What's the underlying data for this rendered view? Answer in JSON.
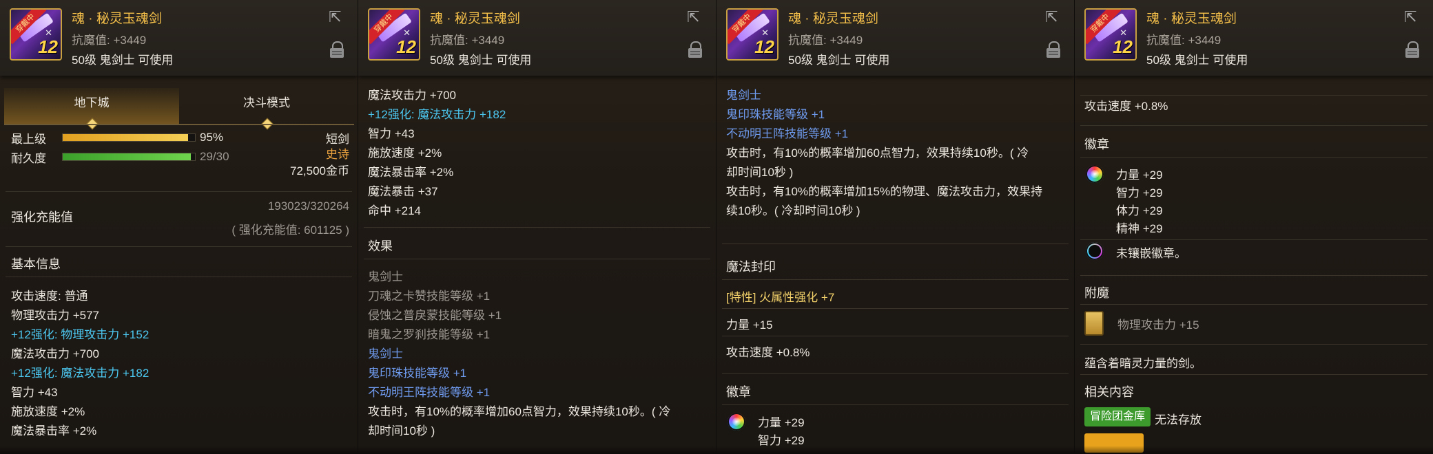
{
  "header": {
    "item_name": "魂 · 秘灵玉魂剑",
    "resistance": "抗魔值: +3449",
    "usage": "50级 鬼剑士 可使用",
    "icon_level": "12",
    "icon_ribbon": "穿戴中"
  },
  "panel1": {
    "tabs": [
      "地下城",
      "决斗模式"
    ],
    "grade_label": "最上级",
    "grade_value": "95%",
    "grade_fraction": 0.95,
    "durability_label": "耐久度",
    "durability_value": "29/30",
    "durability_fraction": 0.967,
    "weapon_type": "短剑",
    "rarity": "史诗",
    "price": "72,500金币",
    "charge_label": "强化充能值",
    "charge_value": "193023/320264",
    "charge_sub": "( 强化充能值: 601125 )",
    "basic_title": "基本信息",
    "lines": [
      "攻击速度: 普通",
      "物理攻击力 +577",
      "+12强化: 物理攻击力 +152",
      "魔法攻击力 +700",
      "+12强化: 魔法攻击力 +182",
      "智力 +43",
      "施放速度 +2%",
      "魔法暴击率 +2%"
    ]
  },
  "panel2": {
    "lines": [
      "魔法攻击力 +700",
      "+12强化: 魔法攻击力 +182",
      "智力 +43",
      "施放速度 +2%",
      "魔法暴击率 +2%",
      "魔法暴击 +37",
      "命中 +214"
    ],
    "effect_title": "效果",
    "effect_lines": [
      "鬼剑士",
      "刀魂之卡赞技能等级 +1",
      "侵蚀之普戾蒙技能等级 +1",
      "暗鬼之罗刹技能等级 +1",
      "鬼剑士",
      "鬼印珠技能等级 +1",
      "不动明王阵技能等级 +1",
      "攻击时，有10%的概率增加60点智力，效果持续10秒。( 冷",
      "却时间10秒 )"
    ]
  },
  "panel3": {
    "lines": [
      "鬼剑士",
      "鬼印珠技能等级 +1",
      "不动明王阵技能等级 +1",
      "攻击时，有10%的概率增加60点智力，效果持续10秒。( 冷",
      "却时间10秒 )",
      "攻击时，有10%的概率增加15%的物理、魔法攻击力，效果持",
      "续10秒。( 冷却时间10秒 )"
    ],
    "seal_title": "魔法封印",
    "seal_trait": "[特性] 火属性强化 +7",
    "seal_str": "力量 +15",
    "seal_speed": "攻击速度 +0.8%",
    "emblem_title": "徽章",
    "emblem_lines": [
      "力量 +29",
      "智力 +29"
    ]
  },
  "panel4": {
    "speed": "攻击速度 +0.8%",
    "emblem_title": "徽章",
    "emblem_lines": [
      "力量 +29",
      "智力 +29",
      "体力 +29",
      "精神 +29"
    ],
    "no_emblem": "未镶嵌徽章。",
    "enchant_title": "附魔",
    "enchant_value": "物理攻击力 +15",
    "flavor": "蕴含着暗灵力量的剑。",
    "related_title": "相关内容",
    "badge_bank": "冒险团金库",
    "badge_bank_text": "无法存放"
  },
  "colors": {
    "title": "#f5c04a",
    "cyan": "#4cc7f0",
    "blue": "#6f9bef",
    "orange": "#f0a640"
  }
}
